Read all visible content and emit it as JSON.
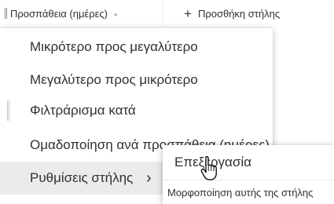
{
  "header": {
    "column_title": "Προσπάθεια (ημέρες)",
    "column_chevron": "⌄",
    "add_column_icon": "plus-icon",
    "add_column_label": "Προσθήκη στήλης"
  },
  "menu": {
    "items": [
      {
        "label": "Μικρότερο προς μεγαλύτερο"
      },
      {
        "label": "Μεγαλύτερο προς μικρότερο"
      },
      {
        "label": "Φιλτράρισμα κατά"
      },
      {
        "label": "Ομαδοποίηση ανά προσπάθεια (ημέρες)"
      },
      {
        "label": "Ρυθμίσεις στήλης",
        "has_submenu": true,
        "selected": true
      }
    ]
  },
  "submenu": {
    "items": [
      {
        "label": "Επεξεργασία"
      },
      {
        "label": "Μορφοποίηση αυτής της στήλης"
      }
    ]
  },
  "colors": {
    "selected_background": "#edebe9",
    "text": "#323130"
  }
}
